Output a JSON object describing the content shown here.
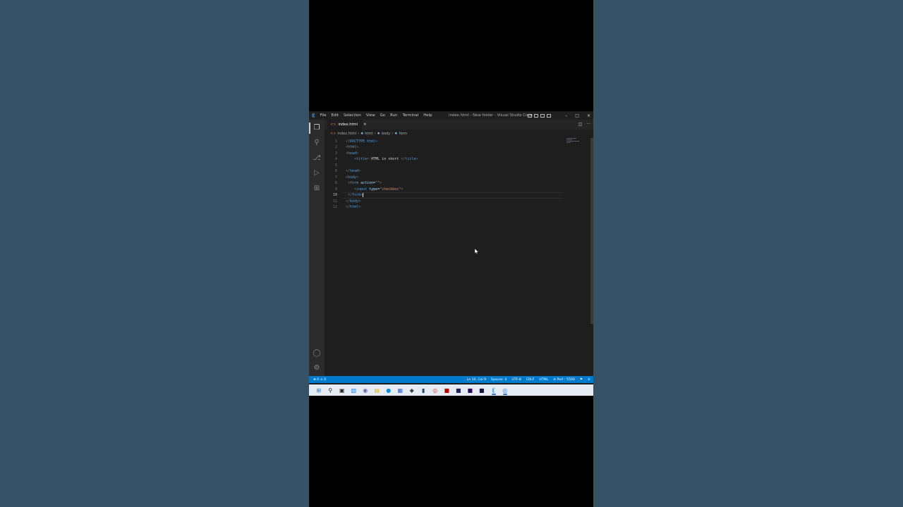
{
  "window": {
    "title": "index.html - New folder - Visual Studio Code",
    "menu": [
      "File",
      "Edit",
      "Selection",
      "View",
      "Go",
      "Run",
      "Terminal",
      "Help"
    ]
  },
  "activity_bar": {
    "icons": [
      "files-icon",
      "search-icon",
      "source-control-icon",
      "run-debug-icon",
      "extensions-icon"
    ],
    "bottom_icons": [
      "account-icon",
      "settings-gear-icon"
    ]
  },
  "tab": {
    "label": "index.html"
  },
  "breadcrumb": [
    "index.html",
    "html",
    "body",
    "form"
  ],
  "editor": {
    "lines": [
      {
        "n": "1",
        "code": "<!DOCTYPE html>"
      },
      {
        "n": "2",
        "code": "<html>"
      },
      {
        "n": "3",
        "code": "<head>"
      },
      {
        "n": "4",
        "code": "    <title> HTML in short </title>"
      },
      {
        "n": "5",
        "code": ""
      },
      {
        "n": "6",
        "code": "</head>"
      },
      {
        "n": "7",
        "code": "<body>"
      },
      {
        "n": "8",
        "code": " <form action=\"\">"
      },
      {
        "n": "9",
        "code": "    <input type=\"checkbox\">"
      },
      {
        "n": "10",
        "code": " </form>"
      },
      {
        "n": "11",
        "code": "</body>"
      },
      {
        "n": "12",
        "code": "</html>"
      }
    ],
    "current_line": "10"
  },
  "status": {
    "problems": "⊗ 0 ⚠ 0",
    "position": "Ln 10, Col 9",
    "spaces": "Spaces: 4",
    "encoding": "UTF-8",
    "eol": "CRLF",
    "language": "HTML",
    "port": "⊘ Port : 5500"
  },
  "taskbar": {
    "apps": [
      "windows-start-icon",
      "search-icon",
      "task-view-icon",
      "widgets-icon",
      "chat-icon",
      "file-explorer-icon",
      "edge-icon",
      "store-icon",
      "app-icon",
      "terminal-icon",
      "chrome-icon",
      "acrobat-icon",
      "media-encoder-icon",
      "after-effects-icon",
      "premiere-icon",
      "vscode-icon",
      "chrome-beta-icon"
    ]
  },
  "colors": {
    "background": "#355266",
    "editor_bg": "#1e1e1e",
    "status_bar": "#007acc",
    "tag": "#569cd6",
    "attr": "#9cdcfe",
    "string": "#ce9178"
  }
}
